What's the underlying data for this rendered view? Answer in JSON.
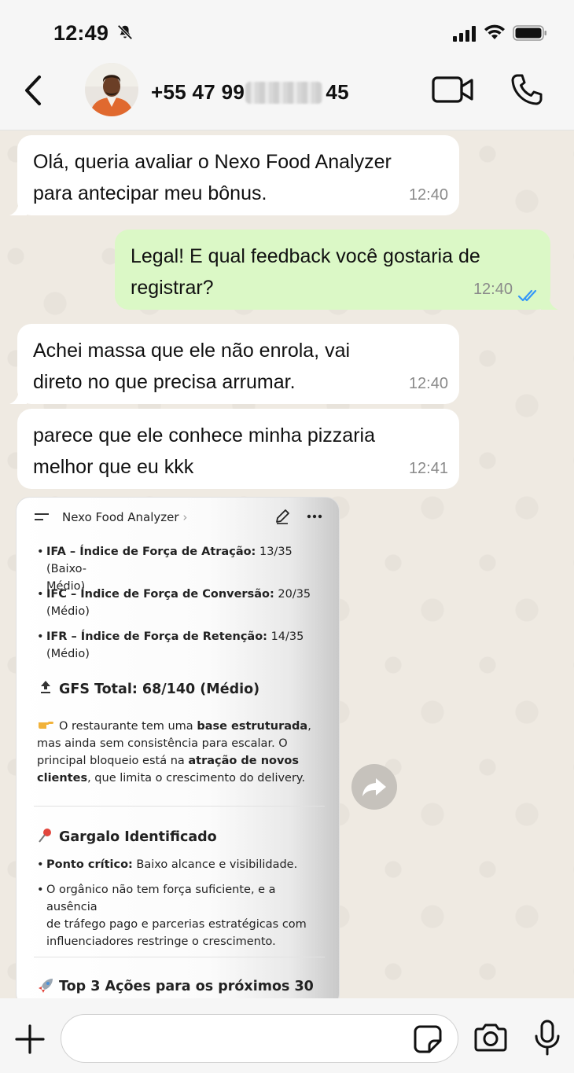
{
  "status_bar": {
    "time": "12:49",
    "icons": [
      "bell-slash-icon",
      "signal-icon",
      "wifi-icon",
      "battery-icon"
    ]
  },
  "header": {
    "contact_name": "+55 47 99       45",
    "icons": [
      "back-icon",
      "video-call-icon",
      "phone-icon"
    ]
  },
  "messages": [
    {
      "direction": "in",
      "text": "Olá, queria avaliar o Nexo Food Analyzer\npara antecipar meu bônus.",
      "time": "12:40"
    },
    {
      "direction": "out",
      "text": "Legal! E qual feedback você gostaria de\nregistrar?",
      "time": "12:40",
      "status": "read"
    },
    {
      "direction": "in",
      "text": "Achei massa que ele não enrola, vai\ndireto no que precisa arrumar.",
      "time": "12:40"
    },
    {
      "direction": "in",
      "text": "parece que ele conhece minha pizzaria\nmelhor que eu kkk",
      "time": "12:41"
    }
  ],
  "shared_image": {
    "app_title": "Nexo Food Analyzer",
    "title_chevron": "›",
    "bullets_top": [
      {
        "bold": "IFA – Índice de Força de Atração:",
        "rest": " 13/35 (Baixo-\nMédio)"
      },
      {
        "bold": "IFC – Índice de Força de Conversão:",
        "rest": " 20/35\n(Médio)"
      },
      {
        "bold": "IFR – Índice de Força de Retenção:",
        "rest": " 14/35\n(Médio)"
      }
    ],
    "gfs_heading": "GFS Total: 68/140 (Médio)",
    "summary_parts": [
      {
        "text": "O restaurante tem uma ",
        "bold": false
      },
      {
        "text": "base estruturada",
        "bold": true
      },
      {
        "text": ", mas ainda sem consistência para escalar. O principal bloqueio está na ",
        "bold": false
      },
      {
        "text": "atração de novos clientes",
        "bold": true
      },
      {
        "text": ", que limita o crescimento do delivery.",
        "bold": false
      }
    ],
    "bottleneck_heading": "Gargalo Identificado",
    "bottleneck_bullets": [
      {
        "bold": "Ponto crítico:",
        "rest": " Baixo alcance e visibilidade."
      },
      {
        "bold": "",
        "rest": "O orgânico não tem força suficiente, e a ausência\nde tráfego pago e parcerias estratégicas com\ninfluenciadores restringe o crescimento."
      }
    ],
    "actions_heading": "Top 3 Ações para os próximos 30"
  },
  "composer": {
    "placeholder": "",
    "icons": [
      "plus-icon",
      "sticker-icon",
      "camera-icon",
      "microphone-icon"
    ]
  },
  "colors": {
    "incoming_bubble": "#ffffff",
    "outgoing_bubble": "#dbf8c6",
    "read_ticks": "#3497f9",
    "chat_background": "#efeae2"
  }
}
